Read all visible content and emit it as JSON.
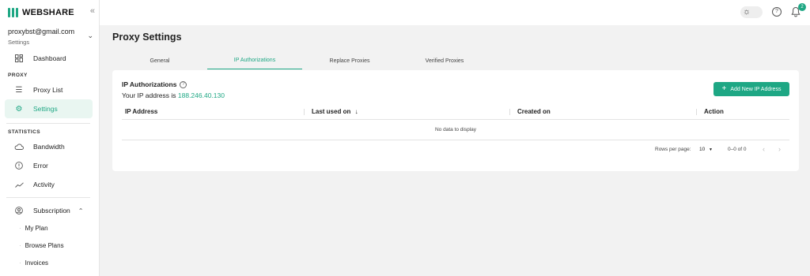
{
  "brand": {
    "name": "WEBSHARE",
    "accent": "#1ea784"
  },
  "sidebar": {
    "collapse_icon": "double-chevron-left-icon",
    "account": {
      "email": "proxybst@gmail.com",
      "context": "Settings"
    },
    "dashboard": {
      "label": "Dashboard",
      "icon": "dashboard-icon"
    },
    "proxy_section": "PROXY",
    "proxy_list": {
      "label": "Proxy List",
      "icon": "list-icon"
    },
    "settings": {
      "label": "Settings",
      "icon": "gear-icon"
    },
    "statistics_section": "STATISTICS",
    "bandwidth": {
      "label": "Bandwidth",
      "icon": "cloud-icon"
    },
    "error": {
      "label": "Error",
      "icon": "alert-icon"
    },
    "activity": {
      "label": "Activity",
      "icon": "trend-icon"
    },
    "subscription": {
      "label": "Subscription",
      "icon": "user-circle-icon"
    },
    "sub_items": [
      "My Plan",
      "Browse Plans",
      "Invoices"
    ]
  },
  "topbar": {
    "notifications_count": "2"
  },
  "page": {
    "title": "Proxy Settings"
  },
  "tabs": [
    "General",
    "IP Authorizations",
    "Replace Proxies",
    "Verified Proxies"
  ],
  "active_tab": "IP Authorizations",
  "card": {
    "title": "IP Authorizations",
    "ip_prefix": "Your IP address is",
    "ip_value": "188.246.40.130",
    "add_button": "Add New IP Address"
  },
  "table": {
    "columns": [
      "IP Address",
      "Last used on",
      "Created on",
      "Action"
    ],
    "sort_indicator": "↓",
    "empty_text": "No data to display",
    "rows_per_page_label": "Rows per page:",
    "rows_per_page_value": "10",
    "range_text": "0–0 of 0"
  }
}
